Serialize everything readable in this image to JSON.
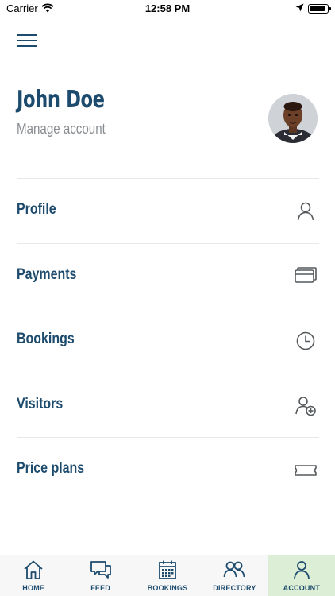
{
  "status_bar": {
    "carrier": "Carrier",
    "time": "12:58 PM"
  },
  "header": {
    "name": "John Doe",
    "manage_link": "Manage account"
  },
  "menu": [
    {
      "label": "Profile",
      "icon": "person-icon"
    },
    {
      "label": "Payments",
      "icon": "cards-icon"
    },
    {
      "label": "Bookings",
      "icon": "clock-icon"
    },
    {
      "label": "Visitors",
      "icon": "add-person-icon"
    },
    {
      "label": "Price plans",
      "icon": "ticket-icon"
    }
  ],
  "tabs": [
    {
      "label": "HOME",
      "icon": "home-icon"
    },
    {
      "label": "FEED",
      "icon": "chat-icon"
    },
    {
      "label": "BOOKINGS",
      "icon": "calendar-icon"
    },
    {
      "label": "DIRECTORY",
      "icon": "people-icon"
    },
    {
      "label": "ACCOUNT",
      "icon": "person-icon",
      "active": true
    }
  ],
  "colors": {
    "primary": "#1d4b6e",
    "secondary_text": "#888c90",
    "active_tab_bg": "#dcefd6",
    "divider": "#e6e8ea"
  }
}
